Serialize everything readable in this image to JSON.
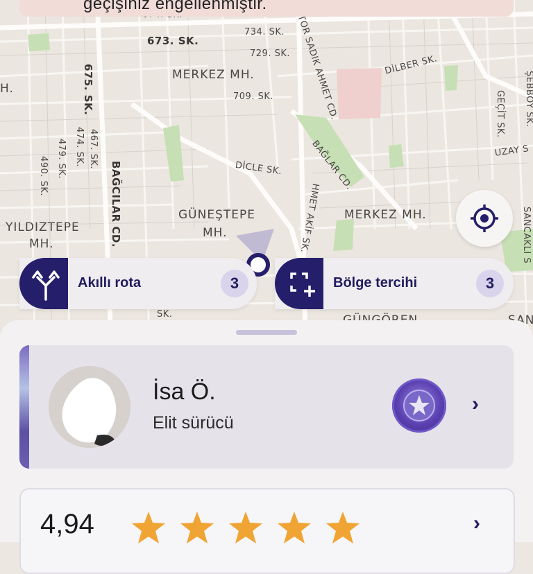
{
  "banner": {
    "text": "geçişiniz engellenmiştir."
  },
  "map": {
    "labels": {
      "sk_674": "674. SK.",
      "sk_673": "673. SK.",
      "sk_734": "734. SK.",
      "sk_729": "729. SK.",
      "sk_709": "709. SK.",
      "sk_675": "675. SK.",
      "sk_467": "467. SK.",
      "sk_474": "474. SK.",
      "sk_479": "479. SK.",
      "sk_490": "490. SK.",
      "merkez_top": "MERKEZ MH.",
      "h_left": "H.",
      "doktor": "TOR SADIK AHMET CD.",
      "dilber": "DİLBER SK.",
      "sebboy": "ŞEBBOY SK.",
      "gecit": "GEÇİT SK.",
      "uzay": "UZAY S",
      "dicle": "DİCLE SK.",
      "baglar": "BAĞLAR CD.",
      "bagcilar": "BAĞCILAR CD.",
      "gunestepe_1": "GÜNEŞTEPE",
      "gunestepe_2": "MH.",
      "yildiztepe_1": "YILDIZTEPE",
      "yildiztepe_2": "MH.",
      "akif": "HMET AKİF SK.",
      "merkez_right": "MERKEZ MH.",
      "sancakli": "SANCAKLI S",
      "gungoren": "GÜNGÖREN",
      "san": "SAN",
      "sk_bottom": "SK."
    }
  },
  "actions": {
    "smart_route": {
      "label": "Akıllı rota",
      "count": "3"
    },
    "region_pref": {
      "label": "Bölge tercihi",
      "count": "3"
    }
  },
  "profile": {
    "name": "İsa Ö.",
    "title": "Elit sürücü"
  },
  "rating": {
    "value": "4,94",
    "stars": 5
  },
  "colors": {
    "brand": "#251f6b",
    "star": "#f0a433",
    "badge": "#d9d4ec"
  },
  "icons": [
    "locate-icon",
    "smart-route-icon",
    "region-select-icon",
    "elite-badge-icon",
    "chevron-right-icon",
    "star-icon"
  ]
}
